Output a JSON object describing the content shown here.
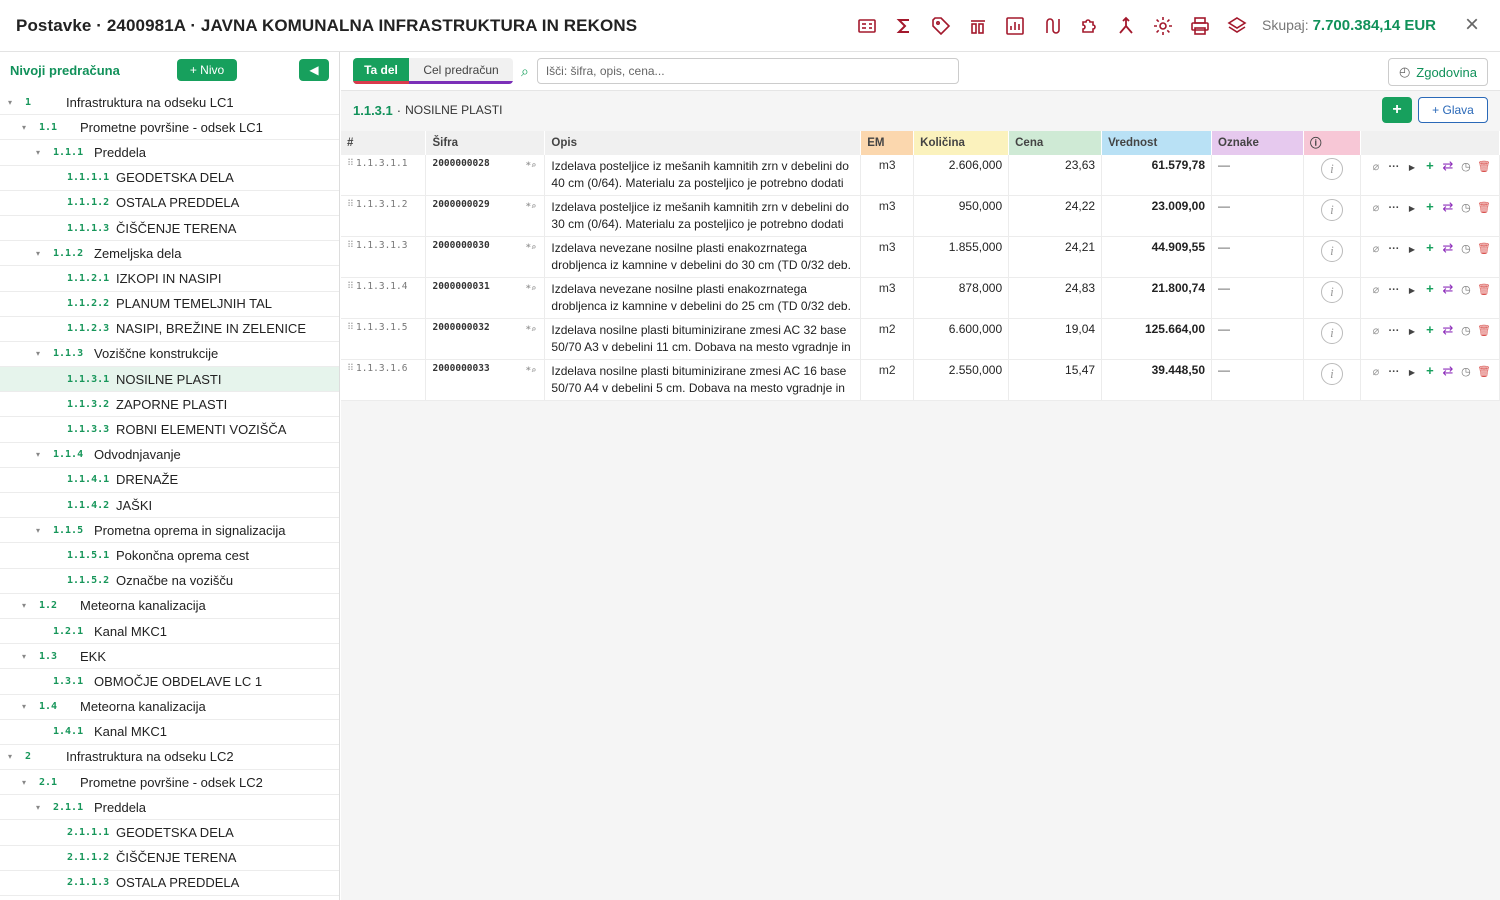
{
  "header": {
    "title": "Postavke · 2400981A · JAVNA KOMUNALNA INFRASTRUKTURA IN REKONS",
    "total_label": "Skupaj:",
    "total_value": "7.700.384,14 EUR",
    "toolbar_icons": [
      "recapitulation-icon",
      "sigma-icon",
      "tag-icon",
      "delete-columns-icon",
      "chart-icon",
      "connections-icon",
      "puzzle-icon",
      "merge-icon",
      "gear-icon",
      "print-icon",
      "layers-icon"
    ],
    "accent_color": "#a3182c",
    "total_color": "#11915a"
  },
  "sidebar": {
    "title": "Nivoji predračuna",
    "add_level_label": "+ Nivo",
    "collapse_label": "◀",
    "tree": [
      {
        "num": "1",
        "label": "Infrastruktura na odseku LC1",
        "depth": 0,
        "caret": true
      },
      {
        "num": "1.1",
        "label": "Prometne površine - odsek LC1",
        "depth": 1,
        "caret": true
      },
      {
        "num": "1.1.1",
        "label": "Preddela",
        "depth": 2,
        "caret": true
      },
      {
        "num": "1.1.1.1",
        "label": "GEODETSKA DELA",
        "depth": 3,
        "caret": false
      },
      {
        "num": "1.1.1.2",
        "label": "OSTALA PREDDELA",
        "depth": 3,
        "caret": false
      },
      {
        "num": "1.1.1.3",
        "label": "ČIŠČENJE TERENA",
        "depth": 3,
        "caret": false
      },
      {
        "num": "1.1.2",
        "label": "Zemeljska dela",
        "depth": 2,
        "caret": true
      },
      {
        "num": "1.1.2.1",
        "label": "IZKOPI IN NASIPI",
        "depth": 3,
        "caret": false
      },
      {
        "num": "1.1.2.2",
        "label": "PLANUM TEMELJNIH TAL",
        "depth": 3,
        "caret": false
      },
      {
        "num": "1.1.2.3",
        "label": "NASIPI, BREŽINE IN ZELENICE",
        "depth": 3,
        "caret": false
      },
      {
        "num": "1.1.3",
        "label": "Voziščne konstrukcije",
        "depth": 2,
        "caret": true
      },
      {
        "num": "1.1.3.1",
        "label": "NOSILNE PLASTI",
        "depth": 3,
        "caret": false,
        "selected": true
      },
      {
        "num": "1.1.3.2",
        "label": "ZAPORNE PLASTI",
        "depth": 3,
        "caret": false
      },
      {
        "num": "1.1.3.3",
        "label": "ROBNI ELEMENTI VOZIŠČA",
        "depth": 3,
        "caret": false
      },
      {
        "num": "1.1.4",
        "label": "Odvodnjavanje",
        "depth": 2,
        "caret": true
      },
      {
        "num": "1.1.4.1",
        "label": "DRENAŽE",
        "depth": 3,
        "caret": false
      },
      {
        "num": "1.1.4.2",
        "label": "JAŠKI",
        "depth": 3,
        "caret": false
      },
      {
        "num": "1.1.5",
        "label": "Prometna oprema in signalizacija",
        "depth": 2,
        "caret": true
      },
      {
        "num": "1.1.5.1",
        "label": "Pokončna oprema cest",
        "depth": 3,
        "caret": false
      },
      {
        "num": "1.1.5.2",
        "label": "Označbe na vozišču",
        "depth": 3,
        "caret": false
      },
      {
        "num": "1.2",
        "label": "Meteorna kanalizacija",
        "depth": 1,
        "caret": true
      },
      {
        "num": "1.2.1",
        "label": "Kanal MKC1",
        "depth": 2,
        "caret": false
      },
      {
        "num": "1.3",
        "label": "EKK",
        "depth": 1,
        "caret": true
      },
      {
        "num": "1.3.1",
        "label": "OBMOČJE OBDELAVE LC 1",
        "depth": 2,
        "caret": false
      },
      {
        "num": "1.4",
        "label": "Meteorna kanalizacija",
        "depth": 1,
        "caret": true
      },
      {
        "num": "1.4.1",
        "label": "Kanal MKC1",
        "depth": 2,
        "caret": false
      },
      {
        "num": "2",
        "label": "Infrastruktura na odseku LC2",
        "depth": 0,
        "caret": true
      },
      {
        "num": "2.1",
        "label": "Prometne površine - odsek LC2",
        "depth": 1,
        "caret": true
      },
      {
        "num": "2.1.1",
        "label": "Preddela",
        "depth": 2,
        "caret": true
      },
      {
        "num": "2.1.1.1",
        "label": "GEODETSKA DELA",
        "depth": 3,
        "caret": false
      },
      {
        "num": "2.1.1.2",
        "label": "ČIŠČENJE TERENA",
        "depth": 3,
        "caret": false
      },
      {
        "num": "2.1.1.3",
        "label": "OSTALA PREDDELA",
        "depth": 3,
        "caret": false
      }
    ]
  },
  "main": {
    "tab_this": "Ta del",
    "tab_all": "Cel predračun",
    "search_placeholder": "Išči: šifra, opis, cena...",
    "history_label": "Zgodovina",
    "crumb_code": "1.1.3.1",
    "crumb_sep": "·",
    "crumb_name": "NOSILNE PLASTI",
    "add_label": "+",
    "chapter_label": "+ Glava",
    "columns": {
      "hash": "#",
      "sifra": "Šifra",
      "opis": "Opis",
      "em": "EM",
      "kolicina": "Količina",
      "cena": "Cena",
      "vrednost": "Vrednost",
      "oznake": "Oznake",
      "info": "ⓘ"
    },
    "rows": [
      {
        "pos": "1.1.3.1.1",
        "sifra": "2000000028",
        "opis": "Izdelava posteljice iz mešanih kamnitih zrn v debelini do 40 cm (0/64). Materialu za posteljico je potrebno dodati",
        "em": "m3",
        "kolicina": "2.606,000",
        "cena": "23,63",
        "vrednost": "61.579,78",
        "oznake": "—"
      },
      {
        "pos": "1.1.3.1.2",
        "sifra": "2000000029",
        "opis": "Izdelava posteljice iz mešanih kamnitih zrn v debelini do 30 cm (0/64). Materialu za posteljico je potrebno dodati",
        "em": "m3",
        "kolicina": "950,000",
        "cena": "24,22",
        "vrednost": "23.009,00",
        "oznake": "—"
      },
      {
        "pos": "1.1.3.1.3",
        "sifra": "2000000030",
        "opis": "Izdelava nevezane nosilne plasti enakozrnatega drobljenca iz kamnine v debelini do  30 cm (TD 0/32 deb.",
        "em": "m3",
        "kolicina": "1.855,000",
        "cena": "24,21",
        "vrednost": "44.909,55",
        "oznake": "—"
      },
      {
        "pos": "1.1.3.1.4",
        "sifra": "2000000031",
        "opis": "Izdelava nevezane nosilne plasti enakozrnatega drobljenca iz kamnine v debelini do 25 cm (TD 0/32 deb.",
        "em": "m3",
        "kolicina": "878,000",
        "cena": "24,83",
        "vrednost": "21.800,74",
        "oznake": "—"
      },
      {
        "pos": "1.1.3.1.5",
        "sifra": "2000000032",
        "opis": "Izdelava nosilne plasti bituminizirane zmesi AC 32 base 50/70 A3 v debelini 11 cm. Dobava na mesto vgradnje in",
        "em": "m2",
        "kolicina": "6.600,000",
        "cena": "19,04",
        "vrednost": "125.664,00",
        "oznake": "—"
      },
      {
        "pos": "1.1.3.1.6",
        "sifra": "2000000033",
        "opis": "Izdelava nosilne plasti bituminizirane zmesi AC 16 base 50/70 A4 v debelini 5 cm. Dobava na mesto vgradnje in",
        "em": "m2",
        "kolicina": "2.550,000",
        "cena": "15,47",
        "vrednost": "39.448,50",
        "oznake": "—"
      }
    ]
  }
}
